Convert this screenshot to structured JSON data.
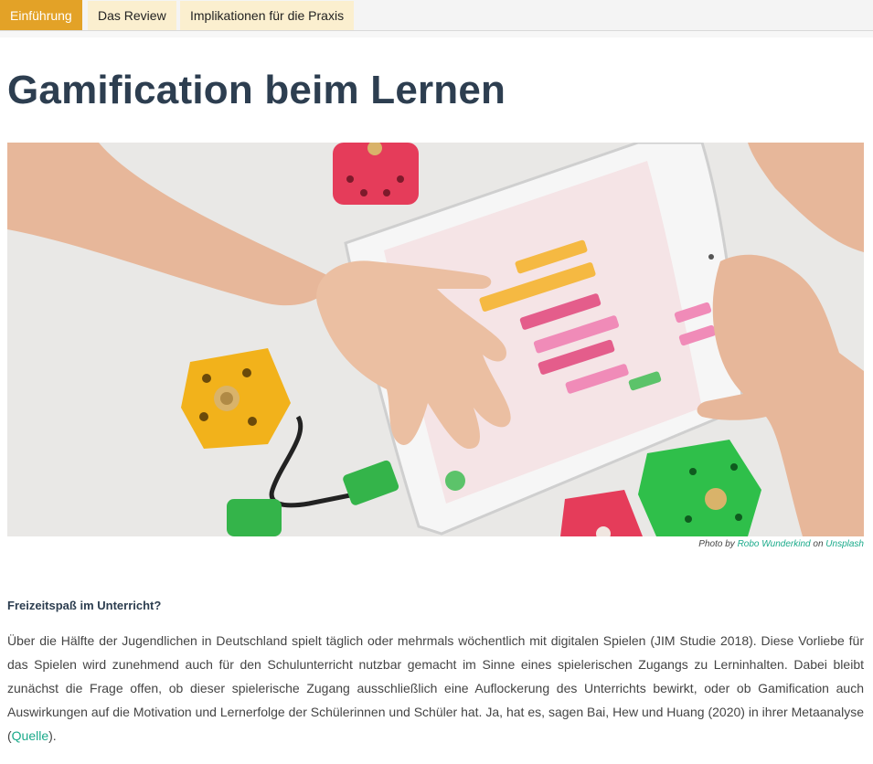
{
  "tabs": [
    {
      "label": "Einführung",
      "active": true
    },
    {
      "label": "Das Review",
      "active": false
    },
    {
      "label": "Implikationen für die Praxis",
      "active": false
    }
  ],
  "page_title": "Gamification beim Lernen",
  "image": {
    "alt": "Kinderhände an einem Tablet mit einer blockbasierten Programmier-App, umgeben von bunten Robotik-Würfeln"
  },
  "caption": {
    "prefix": "Photo by",
    "author": "Robo Wunderkind",
    "middle": "on",
    "source": "Unsplash"
  },
  "section": {
    "heading": "Freizeitspaß im Unterricht?",
    "text": "Über die Hälfte der Jugendlichen in Deutschland spielt täglich oder mehrmals wöchentlich mit digitalen Spielen (JIM Studie 2018). Diese Vorliebe für das Spielen wird zunehmend auch für den Schulunterricht nutzbar gemacht im Sinne eines spielerischen Zugangs zu Lerninhalten. Dabei bleibt zunächst die Frage offen, ob dieser spielerische Zugang ausschließlich eine Auflockerung des Unterrichts bewirkt, oder ob Gamification auch Auswirkungen auf die Motivation und Lernerfolge der Schülerinnen und Schüler hat. Ja, hat es, sagen Bai, Hew und Huang (2020) in ihrer Metaanalyse (",
    "link_label": "Quelle",
    "text_end": ")."
  },
  "colors": {
    "active_tab": "#e3a227",
    "inactive_tab": "#fbefcf",
    "heading": "#2d3e50",
    "link": "#1aaa8a"
  }
}
